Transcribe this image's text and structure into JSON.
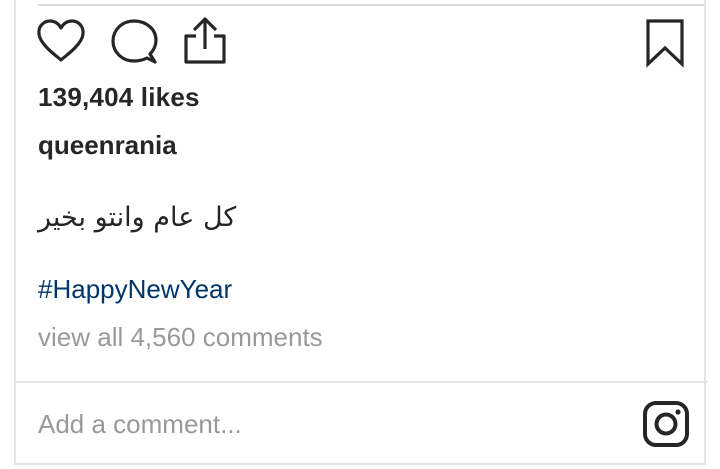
{
  "post": {
    "likes_text": "139,404 likes",
    "username": "queenrania",
    "caption": "كل عام وانتو بخير",
    "hashtag": "#HappyNewYear",
    "view_comments": "view all 4,560 comments"
  },
  "comment_box": {
    "placeholder": "Add a comment..."
  },
  "icons": {
    "like": "heart-icon",
    "comment": "speech-bubble-icon",
    "share": "share-upload-icon",
    "save": "bookmark-icon",
    "app": "instagram-logo-icon"
  },
  "colors": {
    "text": "#262626",
    "hashtag": "#003569",
    "muted": "#999999",
    "divider": "#dbdbdb"
  }
}
